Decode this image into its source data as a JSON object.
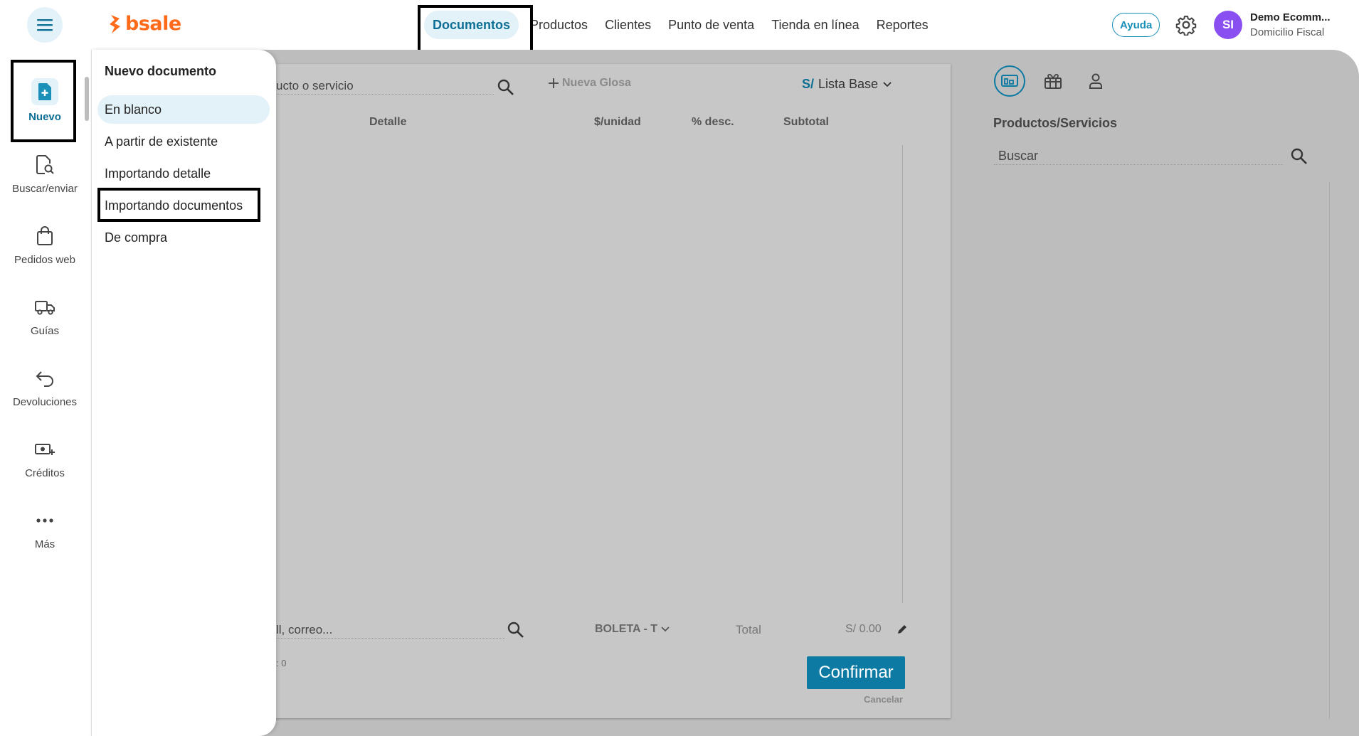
{
  "app": {
    "logo_text": "bsale",
    "brand_color": "#ff6b1a",
    "accent_color": "#0d7aa3"
  },
  "header": {
    "menu_icon": "hamburger-icon",
    "nav": [
      {
        "label": "Documentos",
        "active": true
      },
      {
        "label": "Productos",
        "active": false
      },
      {
        "label": "Clientes",
        "active": false
      },
      {
        "label": "Punto de venta",
        "active": false
      },
      {
        "label": "Tienda en línea",
        "active": false
      },
      {
        "label": "Reportes",
        "active": false
      }
    ],
    "help_label": "Ayuda",
    "settings_icon": "gear-icon",
    "user": {
      "initials": "SI",
      "name": "Demo Ecomm...",
      "subtitle": "Domicilio Fiscal"
    }
  },
  "sidebar": {
    "items": [
      {
        "label": "Nuevo",
        "icon": "new-document-icon",
        "active": true
      },
      {
        "label": "Buscar/enviar",
        "icon": "search-document-icon"
      },
      {
        "label": "Pedidos web",
        "icon": "shopping-bag-icon"
      },
      {
        "label": "Guías",
        "icon": "truck-icon"
      },
      {
        "label": "Devoluciones",
        "icon": "return-arrow-icon"
      },
      {
        "label": "Créditos",
        "icon": "cash-plus-icon"
      },
      {
        "label": "Más",
        "icon": "more-dots-icon"
      }
    ]
  },
  "dropdown": {
    "title": "Nuevo documento",
    "items": [
      {
        "label": "En blanco",
        "selected": true
      },
      {
        "label": "A partir de existente"
      },
      {
        "label": "Importando detalle"
      },
      {
        "label": "Importando documentos"
      },
      {
        "label": "De compra"
      }
    ]
  },
  "document": {
    "search_placeholder_visible": "ucto o servicio",
    "new_glosa": "Nueva Glosa",
    "currency_symbol": "S/",
    "price_list": "Lista Base",
    "columns": [
      "Detalle",
      "$/unidad",
      "% desc.",
      "Subtotal"
    ],
    "client_placeholder_visible": "ll, correo...",
    "doc_type": "BOLETA - T",
    "total_label": "Total",
    "total_value": "S/ 0.00",
    "count_visible": ": 0",
    "confirm_label": "Confirmar",
    "cancel_label": "Cancelar"
  },
  "right_panel": {
    "tabs": [
      "pos-device-icon",
      "gift-icon",
      "person-icon"
    ],
    "title": "Productos/Servicios",
    "search_placeholder": "Buscar"
  }
}
